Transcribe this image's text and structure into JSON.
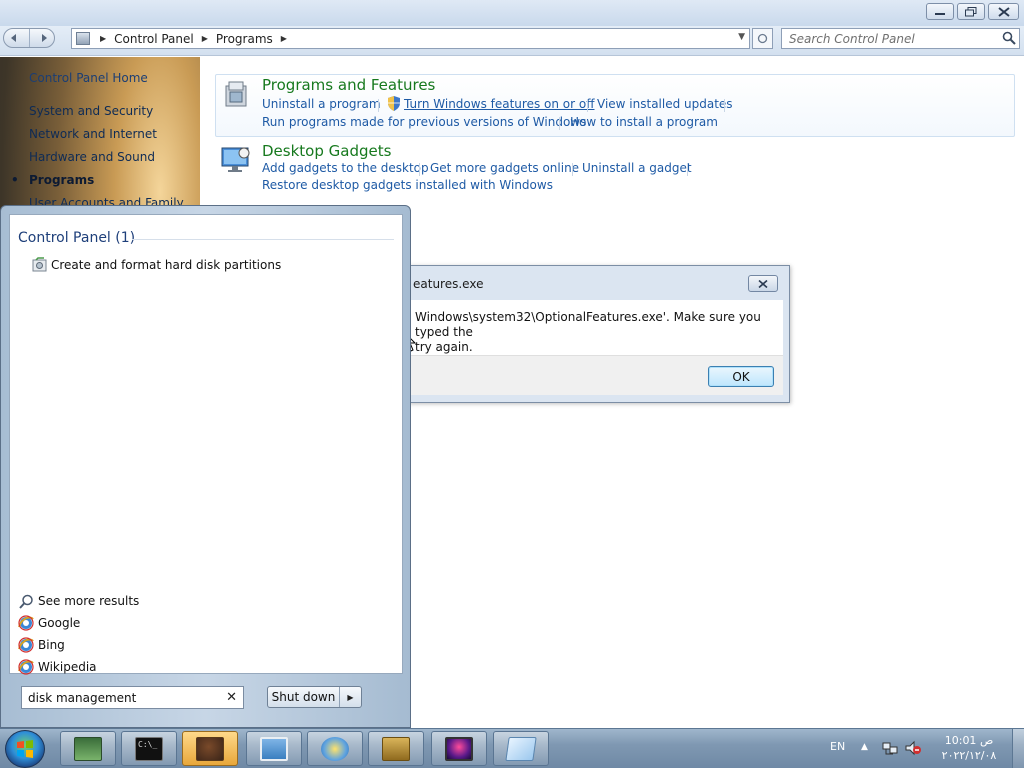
{
  "window": {
    "minimize_glyph": "",
    "maximize_glyph": "",
    "close_glyph": ""
  },
  "address": {
    "breadcrumb": [
      "Control Panel",
      "Programs"
    ],
    "search_placeholder": "Search Control Panel"
  },
  "sidebar": {
    "home_label": "Control Panel Home",
    "items": [
      {
        "label": "System and Security",
        "active": false
      },
      {
        "label": "Network and Internet",
        "active": false
      },
      {
        "label": "Hardware and Sound",
        "active": false
      },
      {
        "label": "Programs",
        "active": true
      },
      {
        "label": "User Accounts and Family",
        "active": false
      }
    ]
  },
  "categories": {
    "programs_features": {
      "title": "Programs and Features",
      "links": [
        "Uninstall a program",
        "Turn Windows features on or off",
        "View installed updates",
        "Run programs made for previous versions of Windows",
        "How to install a program"
      ]
    },
    "desktop_gadgets": {
      "title": "Desktop Gadgets",
      "links": [
        "Add gadgets to the desktop",
        "Get more gadgets online",
        "Uninstall a gadget",
        "Restore desktop gadgets installed with Windows"
      ]
    }
  },
  "dialog": {
    "title": "eatures.exe",
    "message_line1": "Windows\\system32\\OptionalFeatures.exe'. Make sure you typed the",
    "message_line2": "try again.",
    "ok_label": "OK"
  },
  "start_menu": {
    "group_heading": "Control Panel (1)",
    "result_label": "Create and format hard disk partitions",
    "see_more_label": "See more results",
    "web_links": [
      "Google",
      "Bing",
      "Wikipedia"
    ],
    "search_value": "disk management",
    "shutdown_label": "Shut down"
  },
  "taskbar": {
    "language": "EN",
    "time": "10:01 ص",
    "date": "٢٠٢٢/١٢/٠٨"
  },
  "colors": {
    "link": "#1e5aa5",
    "category_title": "#17791e",
    "group_heading": "#1e3f7a"
  }
}
